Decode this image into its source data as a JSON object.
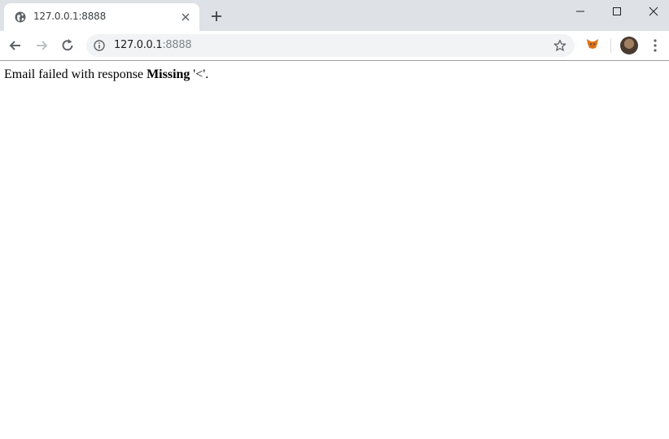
{
  "browser": {
    "tab": {
      "title": "127.0.0.1:8888"
    },
    "address": {
      "host": "127.0.0.1",
      "port": ":8888"
    }
  },
  "page": {
    "message_prefix": "Email failed with response ",
    "message_bold": "Missing",
    "message_suffix": " '<'."
  }
}
